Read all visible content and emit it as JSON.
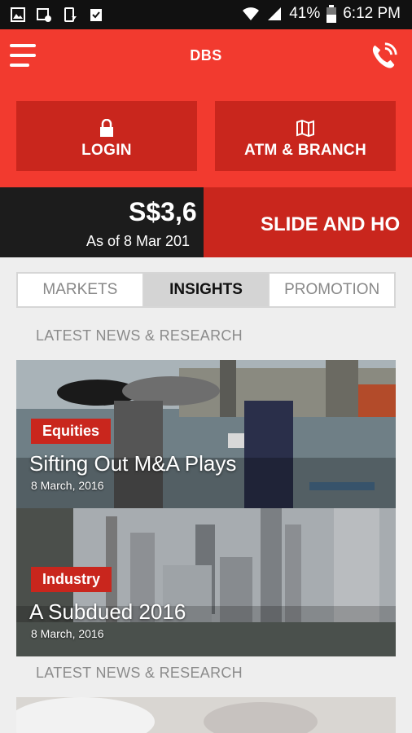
{
  "status_bar": {
    "battery": "41%",
    "time": "6:12 PM"
  },
  "header": {
    "title": "DBS",
    "login_label": "LOGIN",
    "atm_label": "ATM & BRANCH"
  },
  "ticker": {
    "price": "S$3,6",
    "date": "As of 8 Mar 201",
    "slide_label": "SLIDE AND HO"
  },
  "tabs": [
    {
      "label": "MARKETS"
    },
    {
      "label": "INSIGHTS",
      "active": true
    },
    {
      "label": "PROMOTION"
    }
  ],
  "sections": [
    {
      "heading": "LATEST NEWS & RESEARCH"
    },
    {
      "heading": "LATEST NEWS & RESEARCH"
    }
  ],
  "news": [
    {
      "category": "Equities",
      "title": "Sifting Out M&A Plays",
      "date": "8 March, 2016"
    },
    {
      "category": "Industry",
      "title": "A Subdued 2016",
      "date": "8 March, 2016"
    }
  ],
  "colors": {
    "brand_red": "#f23a2f",
    "dark_red": "#c9261d"
  }
}
